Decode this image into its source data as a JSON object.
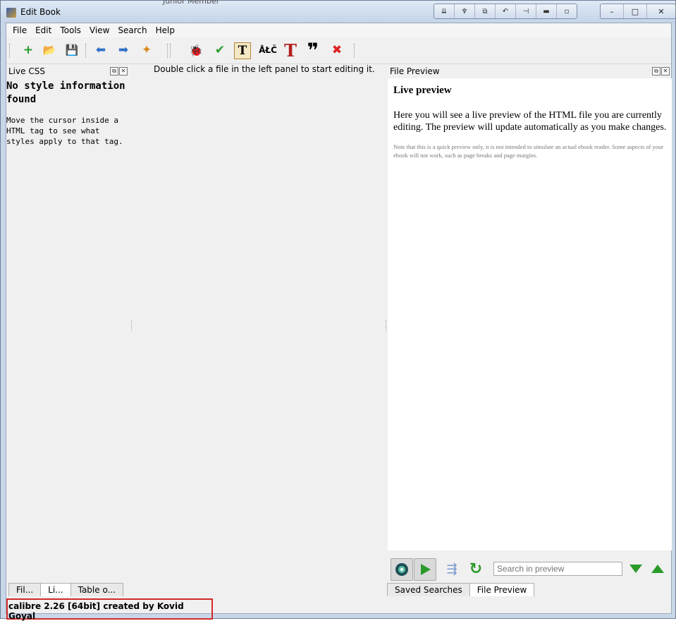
{
  "window": {
    "title": "Edit Book",
    "ghost_text": "Junior Member"
  },
  "title_toolbar_icons": [
    "chevron-down-icon",
    "pin-icon",
    "restore-icon",
    "undo-icon",
    "dock-icon",
    "minus-icon",
    "dot-icon"
  ],
  "window_controls": {
    "minimize": "–",
    "maximize": "□",
    "close": "✕"
  },
  "menu": {
    "file": "File",
    "edit": "Edit",
    "tools": "Tools",
    "view": "View",
    "search": "Search",
    "help": "Help"
  },
  "toolbar": {
    "new_file": "+",
    "open": "📂",
    "save": "💾",
    "back": "⬅",
    "forward": "➡",
    "checkpoint": "✦",
    "check_book": "🐞",
    "spell_check": "✔",
    "insert_tag": "T",
    "insert_char": "ÅŁČ",
    "smarten": "T",
    "quotes": "❞",
    "remove_unused": "✖"
  },
  "live_css": {
    "header": "Live CSS",
    "heading": "No style information found",
    "message": "Move the cursor inside a HTML tag to see what styles apply to that tag."
  },
  "editor_hint": "Double click a file in the left panel to start editing it.",
  "file_preview": {
    "header": "File Preview",
    "heading": "Live preview",
    "paragraph": "Here you will see a live preview of the HTML file you are currently editing. The preview will update automatically as you make changes.",
    "note": "Note that this is a quick preview only, it is not intended to simulate an actual ebook reader. Some aspects of your ebook will not work, such as page breaks and page margins."
  },
  "preview_toolbar": {
    "search_placeholder": "Search in preview"
  },
  "left_tabs": [
    {
      "label": "Fil..."
    },
    {
      "label": "Li..."
    },
    {
      "label": "Table o..."
    }
  ],
  "right_tabs": [
    {
      "label": "Saved Searches"
    },
    {
      "label": "File Preview"
    }
  ],
  "status": "calibre 2.26 [64bit] created by Kovid Goyal",
  "colors": {
    "accent": "#3a6fbf",
    "highlight_border": "#d32a2a",
    "green": "#2a9a2a"
  }
}
